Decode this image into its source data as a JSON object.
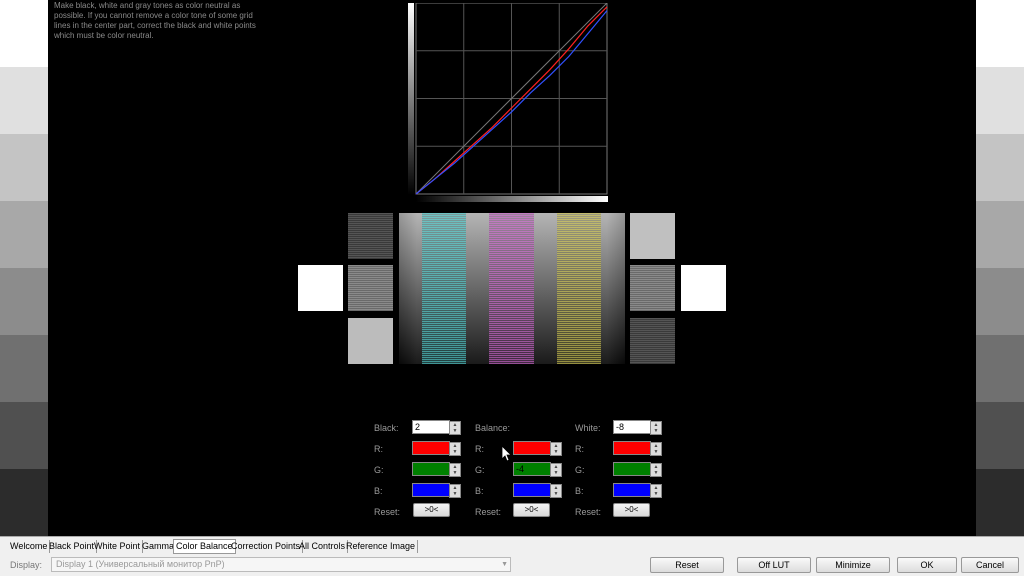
{
  "instructions": "Make black, white and gray tones as color neutral as possible. If you cannot remove a color tone of some grid lines in the center part, correct the black and white points which must be color neutral.",
  "controls": {
    "black": {
      "label": "Black:",
      "value": "2"
    },
    "balance": {
      "label": "Balance:"
    },
    "white": {
      "label": "White:",
      "value": "-8"
    },
    "r_label": "R:",
    "g_label": "G:",
    "b_label": "B:",
    "reset_label": "Reset:",
    "reset_button": ">0<",
    "black_channels": {
      "r": "",
      "g": "",
      "b": ""
    },
    "balance_channels": {
      "r": "",
      "g": "-4",
      "b": ""
    },
    "white_channels": {
      "r": "",
      "g": "",
      "b": ""
    },
    "arrow_up": "▲",
    "arrow_down": "▼"
  },
  "tabs": [
    {
      "label": "Welcome"
    },
    {
      "label": "Black Point"
    },
    {
      "label": "White Point"
    },
    {
      "label": "Gamma"
    },
    {
      "label": "Color Balance",
      "active": true
    },
    {
      "label": "Correction Points"
    },
    {
      "label": "All Controls"
    },
    {
      "label": "Reference Image"
    }
  ],
  "bottom": {
    "display_label": "Display:",
    "display_value": "Display 1 (Универсальный монитор PnP)",
    "reset": "Reset",
    "off_lut": "Off LUT",
    "minimize": "Minimize",
    "ok": "OK",
    "cancel": "Cancel"
  },
  "colors": {
    "red": "#ff0000",
    "green": "#008000",
    "blue": "#0000ff",
    "cyan_stripe": "#4fc6c6",
    "magenta_stripe": "#c060c0",
    "yellow_stripe": "#c8c050"
  },
  "graph_curves": {
    "red": [
      [
        0,
        0
      ],
      [
        0.1,
        0.08
      ],
      [
        0.2,
        0.17
      ],
      [
        0.3,
        0.26
      ],
      [
        0.4,
        0.35
      ],
      [
        0.5,
        0.45
      ],
      [
        0.6,
        0.55
      ],
      [
        0.7,
        0.65
      ],
      [
        0.8,
        0.76
      ],
      [
        0.9,
        0.88
      ],
      [
        1,
        0.98
      ]
    ],
    "blue": [
      [
        0,
        0
      ],
      [
        0.1,
        0.08
      ],
      [
        0.2,
        0.16
      ],
      [
        0.3,
        0.25
      ],
      [
        0.4,
        0.34
      ],
      [
        0.5,
        0.43
      ],
      [
        0.6,
        0.53
      ],
      [
        0.7,
        0.62
      ],
      [
        0.8,
        0.72
      ],
      [
        0.9,
        0.84
      ],
      [
        1,
        0.96
      ]
    ]
  }
}
